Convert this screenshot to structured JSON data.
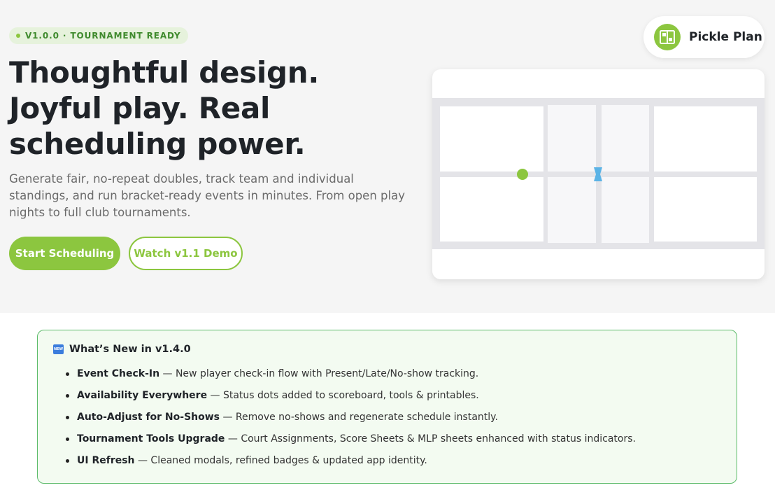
{
  "hero": {
    "badge": "V1.0.0 · TOURNAMENT READY",
    "headline": "Thoughtful design. Joyful play. Real scheduling power.",
    "subtext": "Generate fair, no-repeat doubles, track team and individual standings, and run bracket-ready events in minutes. From open play nights to full club tournaments.",
    "primary_button": "Start Scheduling",
    "secondary_button": "Watch v1.1 Demo"
  },
  "brand": {
    "name": "Pickle Plan",
    "logo_icon": "court-logo-icon"
  },
  "court_illustration": {
    "ball_color": "#8cc63f",
    "net_marker_color": "#5bb3e6"
  },
  "whats_new": {
    "icon": "new-badge-icon",
    "title": "What’s New in v1.4.0",
    "items": [
      {
        "name": "Event Check-In",
        "text": " — New player check-in flow with Present/Late/No-show tracking."
      },
      {
        "name": "Availability Everywhere",
        "text": " — Status dots added to scoreboard, tools & printables."
      },
      {
        "name": "Auto-Adjust for No-Shows",
        "text": " — Remove no-shows and regenerate schedule instantly."
      },
      {
        "name": "Tournament Tools Upgrade",
        "text": " — Court Assignments, Score Sheets & MLP sheets enhanced with status indicators."
      },
      {
        "name": "UI Refresh",
        "text": " — Cleaned modals, refined badges & updated app identity."
      }
    ]
  },
  "colors": {
    "accent": "#8cc63f",
    "badge_text": "#3f8a2d",
    "news_border": "#5cbb6a",
    "news_bg": "#f3fbf1"
  }
}
